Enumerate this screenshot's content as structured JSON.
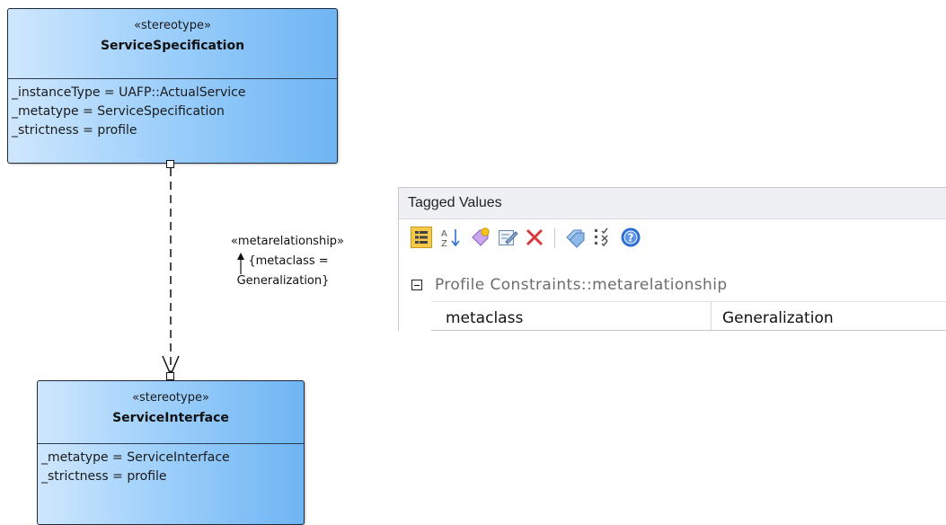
{
  "diagram": {
    "service_specification": {
      "stereotype": "«stereotype»",
      "name": "ServiceSpecification",
      "attributes": [
        "_instanceType = UAFP::ActualService",
        "_metatype = ServiceSpecification",
        "_strictness = profile"
      ]
    },
    "service_interface": {
      "stereotype": "«stereotype»",
      "name": "ServiceInterface",
      "attributes": [
        "_metatype = ServiceInterface",
        "_strictness = profile"
      ]
    },
    "connector": {
      "stereotype": "«metarelationship»",
      "constraint_line1": "{metaclass =",
      "constraint_line2": "Generalization}"
    }
  },
  "tagged_values": {
    "title": "Tagged Values",
    "toolbar": [
      "group-by-category-icon",
      "sort-alphabetically-icon",
      "new-tag-icon",
      "edit-notes-icon",
      "delete-tag-icon",
      "tag-set-icon",
      "show-inherited-icon",
      "help-icon"
    ],
    "group": {
      "label": "Profile Constraints::metarelationship"
    },
    "rows": [
      {
        "name": "metaclass",
        "value": "Generalization"
      }
    ]
  },
  "colors": {
    "class_fill_light": "#cfe7fd",
    "class_fill_dark": "#6fb5f3",
    "panel_header": "#eef0f3",
    "delete_red": "#d83a3a",
    "help_blue": "#2b6fd6"
  }
}
